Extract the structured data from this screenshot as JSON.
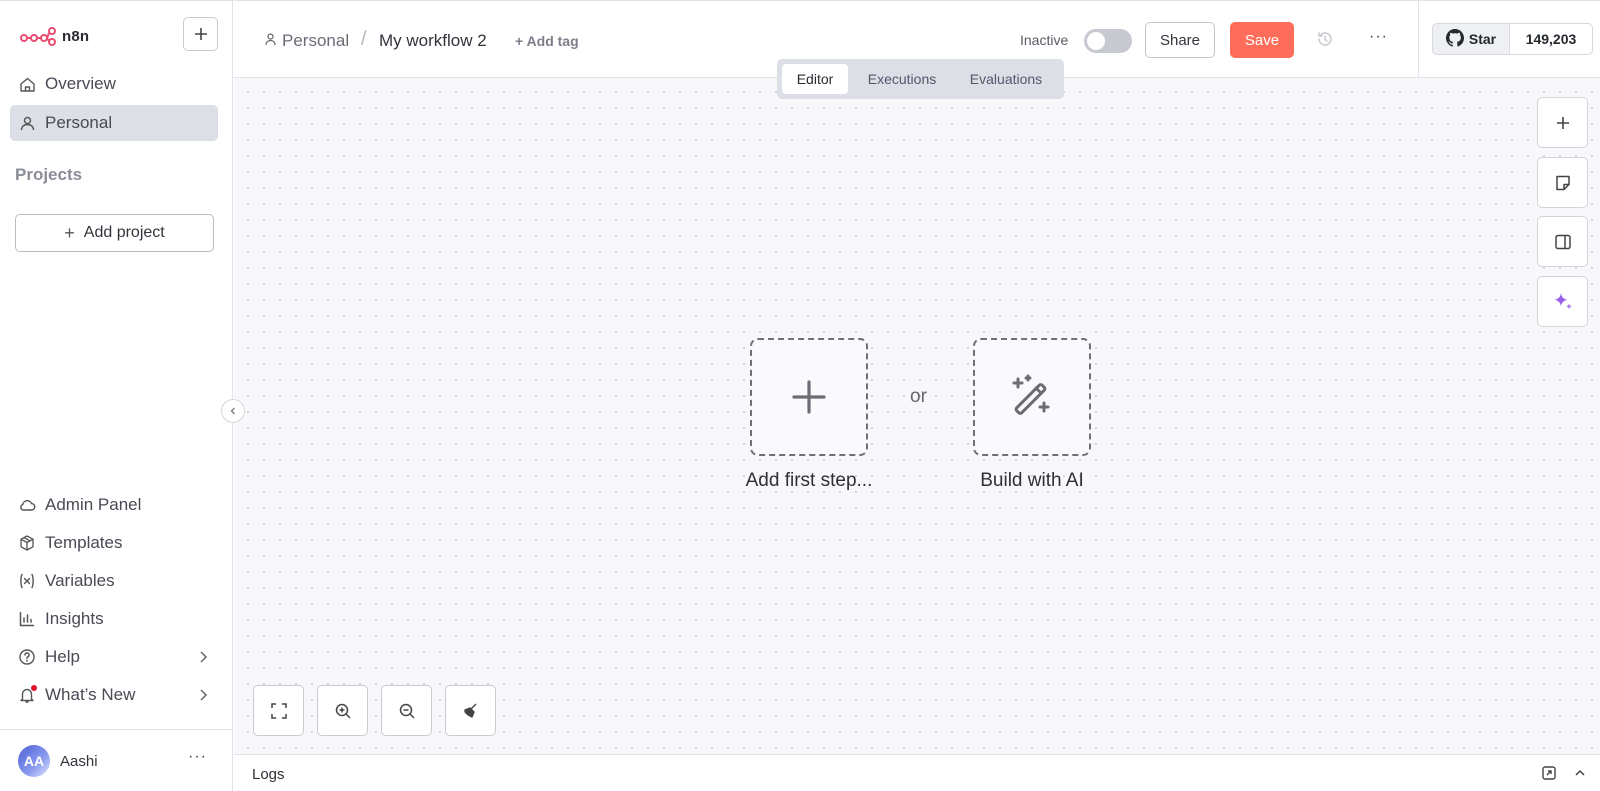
{
  "app": {
    "logo_text": "n8n",
    "brand_color": "#ff6d5a",
    "accent_color": "#ea4b71"
  },
  "sidebar": {
    "new_button_icon": "plus-icon",
    "top_items": [
      {
        "label": "Overview",
        "icon": "home-icon"
      },
      {
        "label": "Personal",
        "icon": "user-icon",
        "active": true
      }
    ],
    "projects_label": "Projects",
    "add_project_label": "Add project",
    "bottom_items": [
      {
        "label": "Admin Panel",
        "icon": "cloud-icon"
      },
      {
        "label": "Templates",
        "icon": "box-icon"
      },
      {
        "label": "Variables",
        "icon": "variable-icon"
      },
      {
        "label": "Insights",
        "icon": "chart-icon"
      },
      {
        "label": "Help",
        "icon": "help-icon"
      },
      {
        "label": "What’s New",
        "icon": "bell-icon"
      }
    ],
    "user": {
      "initials": "AA",
      "name": "Aashi"
    }
  },
  "header": {
    "breadcrumb_project": "Personal",
    "breadcrumb_separator": "/",
    "workflow_name": "My workflow 2",
    "add_tag_label": "+ Add tag",
    "status_label": "Inactive",
    "active_toggle": false,
    "share_label": "Share",
    "save_label": "Save",
    "github": {
      "star_label": "Star",
      "count": "149,203"
    }
  },
  "tabs": [
    {
      "label": "Editor",
      "active": true
    },
    {
      "label": "Executions",
      "active": false
    },
    {
      "label": "Evaluations",
      "active": false
    }
  ],
  "canvas": {
    "add_first_step_label": "Add first step...",
    "or_label": "or",
    "build_with_ai_label": "Build with AI"
  },
  "logs": {
    "label": "Logs"
  }
}
